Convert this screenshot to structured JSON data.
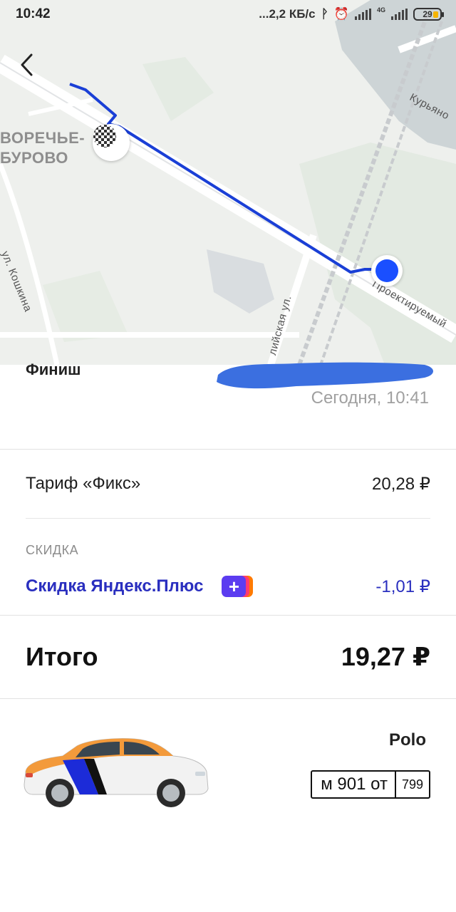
{
  "status_bar": {
    "time": "10:42",
    "speed": "...2,2 КБ/с",
    "network": "4G",
    "battery": "29"
  },
  "map": {
    "district_line1": "ВОРЕЧЬЕ-",
    "district_line2": "БУРОВО",
    "street_koshkina": "ул. Кошкина",
    "street_kuryan": "Курьяно",
    "street_proekt": "Проектируемый",
    "street_lii": "лийская ул.",
    "route_color": "#1a3fd6",
    "start_color": "#1a4fff"
  },
  "trip": {
    "finish_label": "Финиш",
    "finish_time": "Сегодня, 10:41"
  },
  "tariff": {
    "label": "Тариф «Фикс»",
    "value": "20,28 ₽"
  },
  "discount": {
    "section_title": "СКИДКА",
    "label": "Скидка Яндекс.Плюс",
    "badge": "+",
    "value": "-1,01 ₽"
  },
  "total": {
    "label": "Итого",
    "value": "19,27 ₽"
  },
  "car": {
    "model": "Polo",
    "plate_main": "м 901 от",
    "plate_region": "799"
  }
}
